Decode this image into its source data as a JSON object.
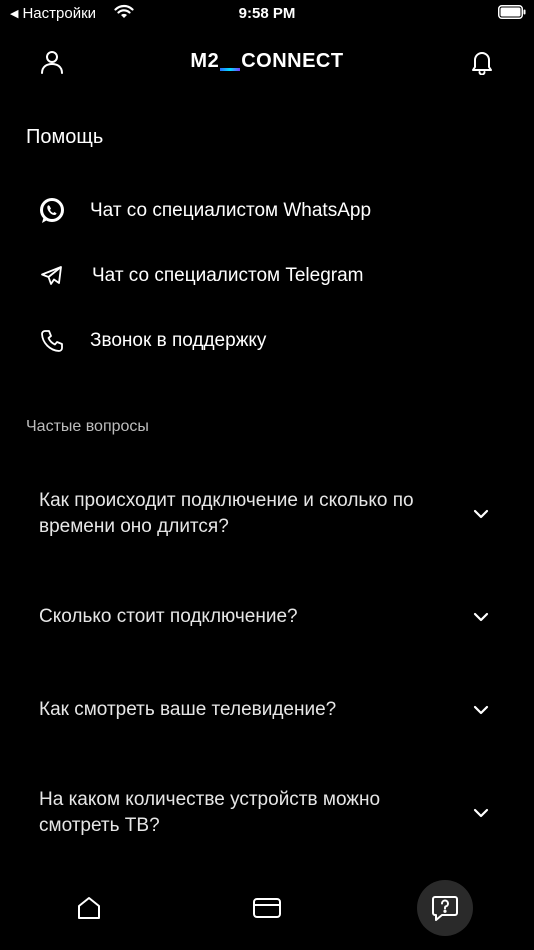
{
  "status_bar": {
    "back_label": "Настройки",
    "time": "9:58 PM"
  },
  "header": {
    "logo_left": "M2",
    "logo_right": "CONNECT"
  },
  "help": {
    "title": "Помощь",
    "contacts": [
      {
        "label": "Чат со специалистом WhatsApp",
        "icon": "whatsapp-icon"
      },
      {
        "label": "Чат со специалистом Telegram",
        "icon": "telegram-icon"
      },
      {
        "label": "Звонок в поддержку",
        "icon": "phone-icon"
      }
    ]
  },
  "faq": {
    "caption": "Частые вопросы",
    "items": [
      {
        "question": "Как происходит подключение и сколько по времени оно длится?"
      },
      {
        "question": "Сколько стоит подключение?"
      },
      {
        "question": "Как смотреть ваше телевидение?"
      },
      {
        "question": "На каком количестве устройств можно смотреть ТВ?"
      }
    ]
  },
  "tabbar": {
    "tabs": [
      {
        "icon": "home-icon"
      },
      {
        "icon": "card-icon"
      },
      {
        "icon": "help-chat-icon",
        "active": true
      }
    ]
  },
  "colors": {
    "background": "#000000",
    "text": "#ffffff",
    "muted": "#bdbdbd",
    "active_tab": "#2a2a2a"
  }
}
